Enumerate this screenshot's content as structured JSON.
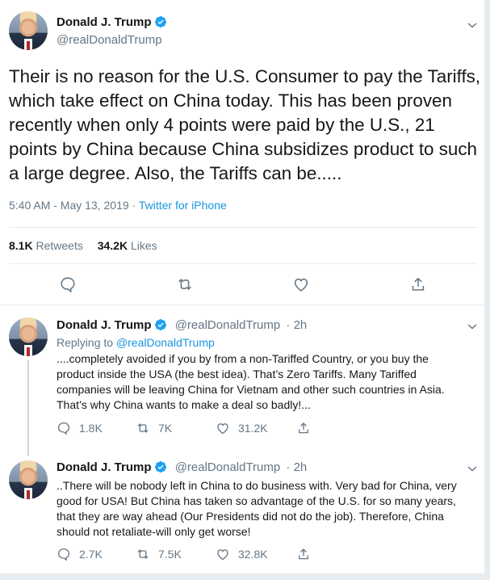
{
  "main_tweet": {
    "name": "Donald J. Trump",
    "handle": "@realDonaldTrump",
    "text": "Their is no reason for the U.S. Consumer to pay the Tariffs, which take effect on China today. This has been proven recently when only 4 points were paid by the U.S., 21 points by China because China subsidizes product to such a large degree. Also, the Tariffs can be.....",
    "time": "5:40 AM - May 13, 2019",
    "dot": " · ",
    "source": "Twitter for iPhone",
    "retweets_count": "8.1K",
    "retweets_label": "Retweets",
    "likes_count": "34.2K",
    "likes_label": "Likes"
  },
  "replies": [
    {
      "name": "Donald J. Trump",
      "handle": "@realDonaldTrump",
      "age": "· 2h",
      "replying_prefix": "Replying to ",
      "replying_to": "@realDonaldTrump",
      "text": "....completely avoided if you by from a non-Tariffed Country, or you buy the product inside the USA (the best idea). That’s Zero Tariffs. Many Tariffed companies will be leaving China for Vietnam and other such countries in Asia. That’s why China wants to make a deal so badly!...",
      "reply_count": "1.8K",
      "retweet_count": "7K",
      "like_count": "31.2K"
    },
    {
      "name": "Donald J. Trump",
      "handle": "@realDonaldTrump",
      "age": "· 2h",
      "text": "..There will be nobody left in China to do business with. Very bad for China, very good for USA! But China has taken so advantage of the U.S. for so many years, that they are way ahead (Our Presidents did not do the job). Therefore, China should not retaliate-will only get worse!",
      "reply_count": "2.7K",
      "retweet_count": "7.5K",
      "like_count": "32.8K"
    }
  ],
  "icons": {
    "verified": "verified-badge-icon",
    "chevron": "chevron-down-icon",
    "reply": "reply-icon",
    "retweet": "retweet-icon",
    "like": "heart-icon",
    "share": "share-icon"
  },
  "colors": {
    "accent": "#1da1f2",
    "link": "#1b95e0",
    "muted": "#657786",
    "text": "#14171a"
  }
}
